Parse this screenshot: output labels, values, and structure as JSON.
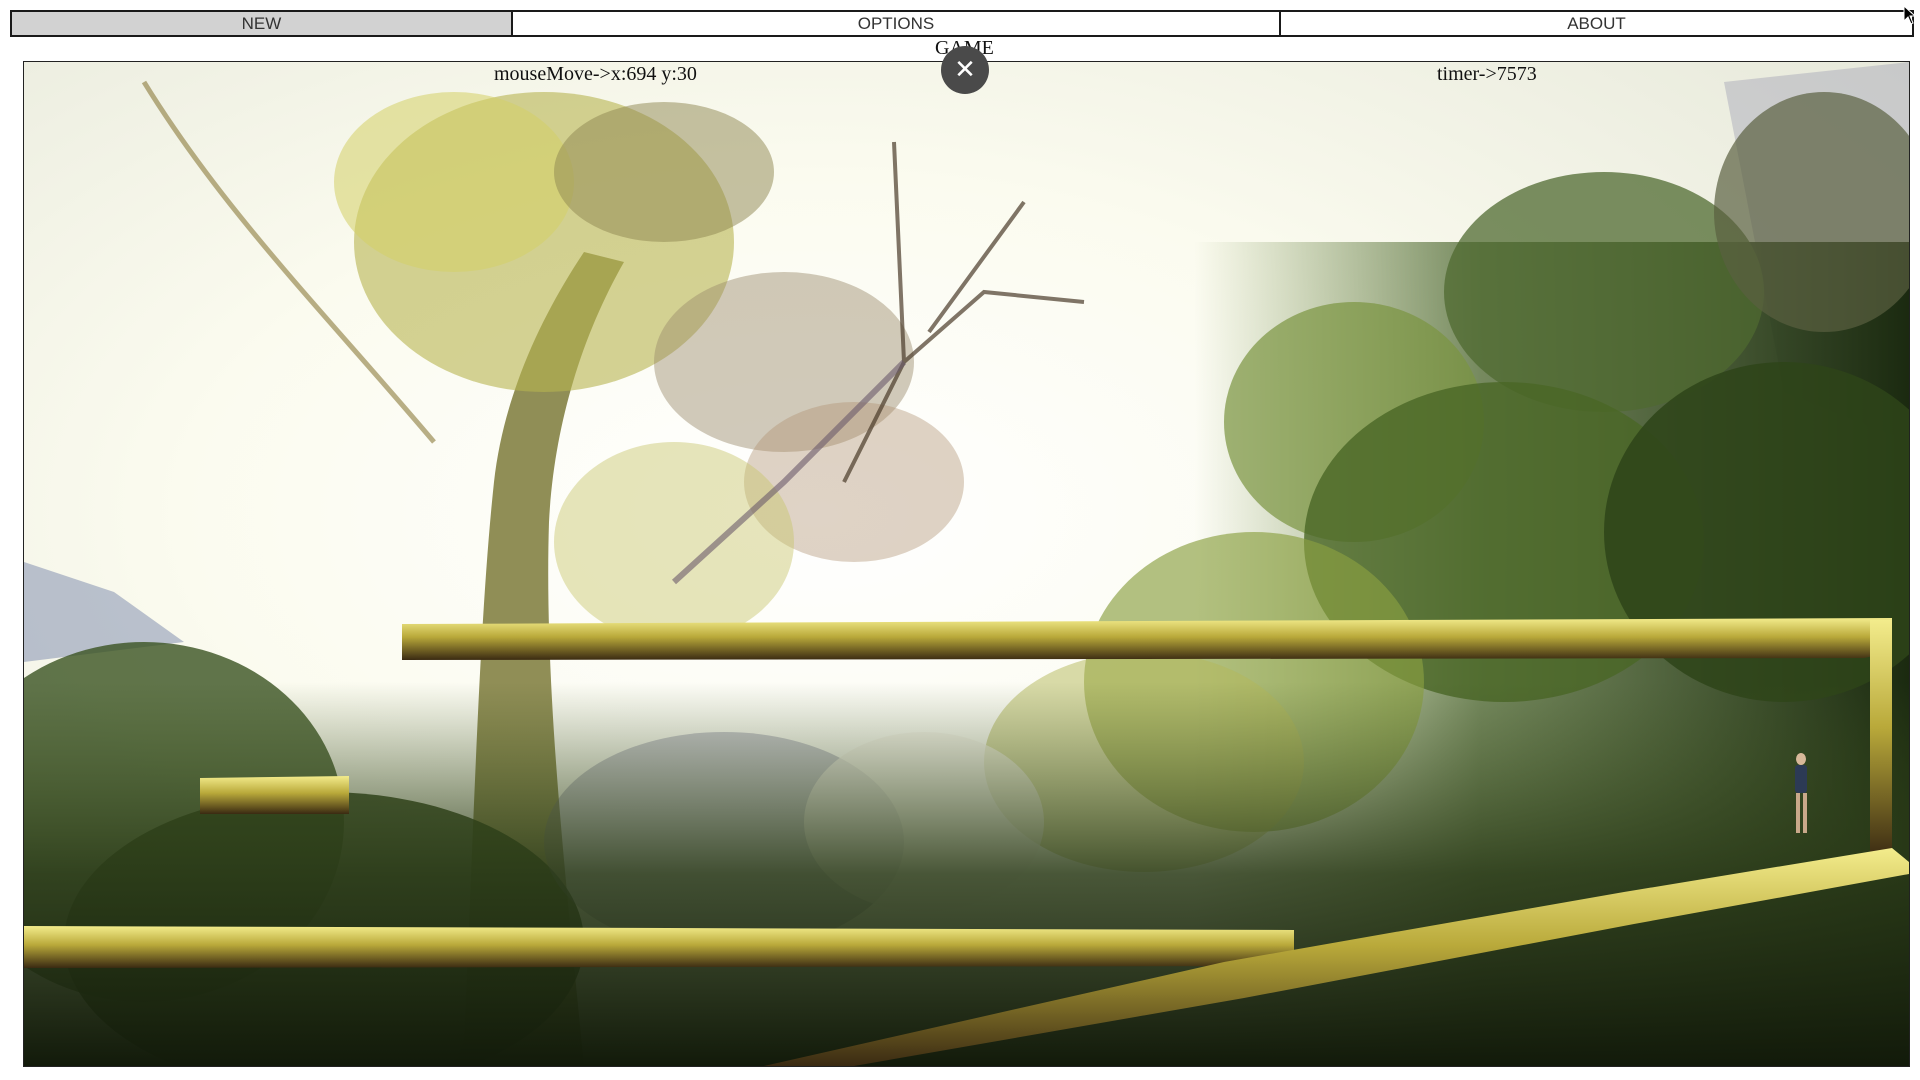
{
  "menu": {
    "new_label": "NEW",
    "options_label": "OPTIONS",
    "about_label": "ABOUT",
    "active": "NEW"
  },
  "game": {
    "title": "GAME",
    "mouse_readout": "mouseMove->x:694 y:30",
    "timer_readout": "timer->7573",
    "close_icon": "close-icon"
  },
  "colors": {
    "menu_active_bg": "#d2d2d2",
    "close_button_bg": "#4a4a4a",
    "platform_moss": "#c8b83a"
  }
}
